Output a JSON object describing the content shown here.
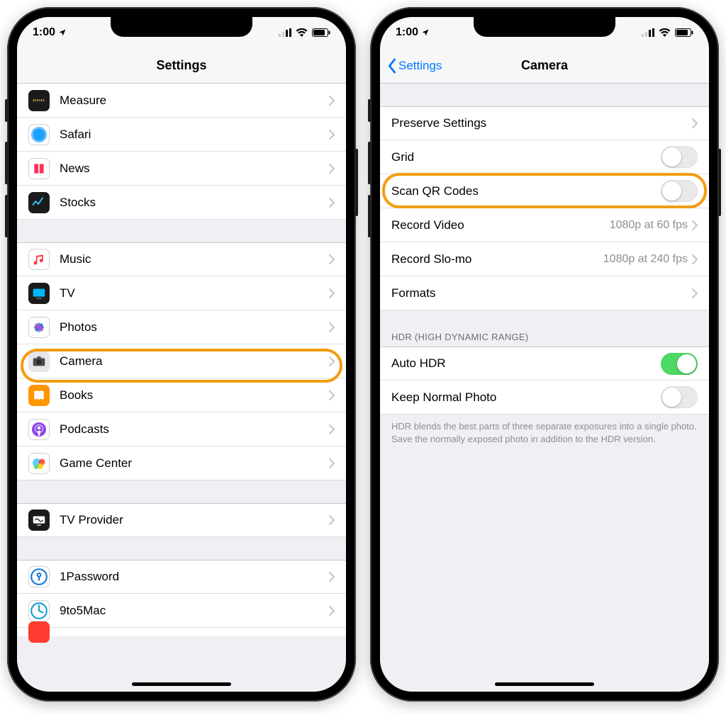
{
  "status": {
    "time": "1:00"
  },
  "left": {
    "title": "Settings",
    "g1": [
      {
        "label": "Measure"
      },
      {
        "label": "Safari"
      },
      {
        "label": "News"
      },
      {
        "label": "Stocks"
      }
    ],
    "g2": [
      {
        "label": "Music"
      },
      {
        "label": "TV"
      },
      {
        "label": "Photos"
      },
      {
        "label": "Camera"
      },
      {
        "label": "Books"
      },
      {
        "label": "Podcasts"
      },
      {
        "label": "Game Center"
      }
    ],
    "g3": [
      {
        "label": "TV Provider"
      }
    ],
    "g4": [
      {
        "label": "1Password"
      },
      {
        "label": "9to5Mac"
      }
    ],
    "highlighted": "Camera"
  },
  "right": {
    "back": "Settings",
    "title": "Camera",
    "rows": {
      "preserve": "Preserve Settings",
      "grid": "Grid",
      "scanqr": "Scan QR Codes",
      "recvideo_label": "Record Video",
      "recvideo_value": "1080p at 60 fps",
      "recslomo_label": "Record Slo-mo",
      "recslomo_value": "1080p at 240 fps",
      "formats": "Formats"
    },
    "hdr_header": "HDR (HIGH DYNAMIC RANGE)",
    "hdr": {
      "auto": "Auto HDR",
      "keep": "Keep Normal Photo"
    },
    "hdr_footer": "HDR blends the best parts of three separate exposures into a single photo. Save the normally exposed photo in addition to the HDR version.",
    "toggles": {
      "grid": false,
      "scanqr": false,
      "auto_hdr": true,
      "keep_normal": false
    },
    "highlighted": "Scan QR Codes"
  }
}
